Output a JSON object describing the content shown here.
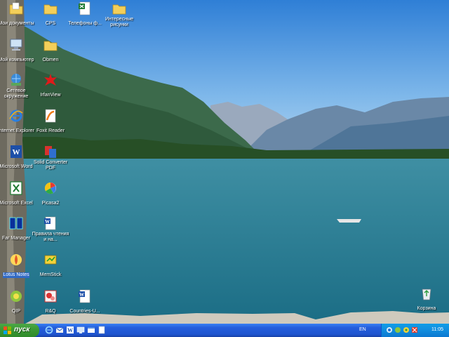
{
  "desktop": {
    "icons": [
      {
        "label": "Мои документы",
        "icon": "folder-documents-icon"
      },
      {
        "label": "CPS",
        "icon": "folder-icon"
      },
      {
        "label": "Телефоны ф...",
        "icon": "excel-file-icon"
      },
      {
        "label": "Интересные рисунки",
        "icon": "folder-icon"
      },
      {
        "label": "Мой компьютер",
        "icon": "my-computer-icon"
      },
      {
        "label": "Obmen",
        "icon": "folder-icon"
      },
      {
        "label": "Сетевое окружение",
        "icon": "network-icon"
      },
      {
        "label": "IrfanView",
        "icon": "irfanview-icon"
      },
      {
        "label": "Internet Explorer",
        "icon": "internet-explorer-icon"
      },
      {
        "label": "Foxit Reader",
        "icon": "foxit-reader-icon"
      },
      {
        "label": "Microsoft Word",
        "icon": "word-icon"
      },
      {
        "label": "Solid Converter PDF",
        "icon": "solid-converter-icon"
      },
      {
        "label": "Microsoft Excel",
        "icon": "excel-icon"
      },
      {
        "label": "Picasa2",
        "icon": "picasa-icon"
      },
      {
        "label": "Far Manager",
        "icon": "far-manager-icon"
      },
      {
        "label": "Правила чтения и на...",
        "icon": "word-document-icon"
      },
      {
        "label": "Lotus Notes",
        "icon": "lotus-notes-icon"
      },
      {
        "label": "MemStick",
        "icon": "memstick-icon"
      },
      {
        "label": "QIP",
        "icon": "qip-icon"
      },
      {
        "label": "R&Q",
        "icon": "rnq-icon"
      },
      {
        "label": "Countries-U...",
        "icon": "word-document-icon"
      },
      {
        "label": "Корзина",
        "icon": "recycle-bin-icon"
      }
    ],
    "selected_icon": "Lotus Notes"
  },
  "taskbar": {
    "start_label": "пуск",
    "language": "EN",
    "clock": "11:05",
    "colors": {
      "taskbar": "#245edc",
      "start": "#3c9a36",
      "tray": "#1290e0"
    }
  }
}
